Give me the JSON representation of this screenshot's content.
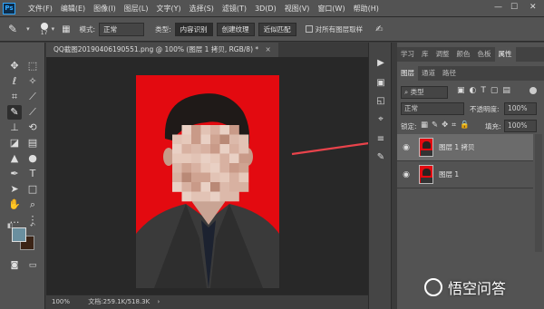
{
  "menubar": {
    "logo": "Ps",
    "items": [
      "文件(F)",
      "编辑(E)",
      "图像(I)",
      "图层(L)",
      "文字(Y)",
      "选择(S)",
      "滤镜(T)",
      "3D(D)",
      "视图(V)",
      "窗口(W)",
      "帮助(H)"
    ],
    "minimize": "—",
    "maximize": "☐",
    "close": "✕"
  },
  "options": {
    "brush_size": "17",
    "mode_label": "模式:",
    "mode_value": "正常",
    "type_label": "类型:",
    "type_buttons": [
      "内容识别",
      "创建纹理",
      "近似匹配"
    ],
    "sample_all_label": "对所有图层取样"
  },
  "document": {
    "tab_title": "QQ截图20190406190551.png @ 100% (图层 1 拷贝, RGB/8) *",
    "tab_close": "×",
    "zoom": "100%",
    "doc_info": "文档:259.1K/518.3K",
    "status_arrow": "›"
  },
  "panel": {
    "top_tabs": [
      "学习",
      "库",
      "调整",
      "颜色",
      "色板",
      "属性"
    ],
    "layer_tabs": [
      "图层",
      "通道",
      "路径"
    ],
    "filter_label": "类型",
    "blend_mode": "正常",
    "opacity_label": "不透明度:",
    "opacity_value": "100%",
    "lock_label": "锁定:",
    "fill_label": "填充:",
    "fill_value": "100%",
    "layers": [
      {
        "name": "图层 1 拷贝",
        "selected": true
      },
      {
        "name": "图层 1",
        "selected": false
      }
    ]
  },
  "watermark": {
    "text": "悟空问答"
  },
  "colors": {
    "foreground": "#6a8f9f",
    "background": "#3b2416",
    "photo_bg": "#e30a10",
    "arrow": "#e8434b"
  }
}
